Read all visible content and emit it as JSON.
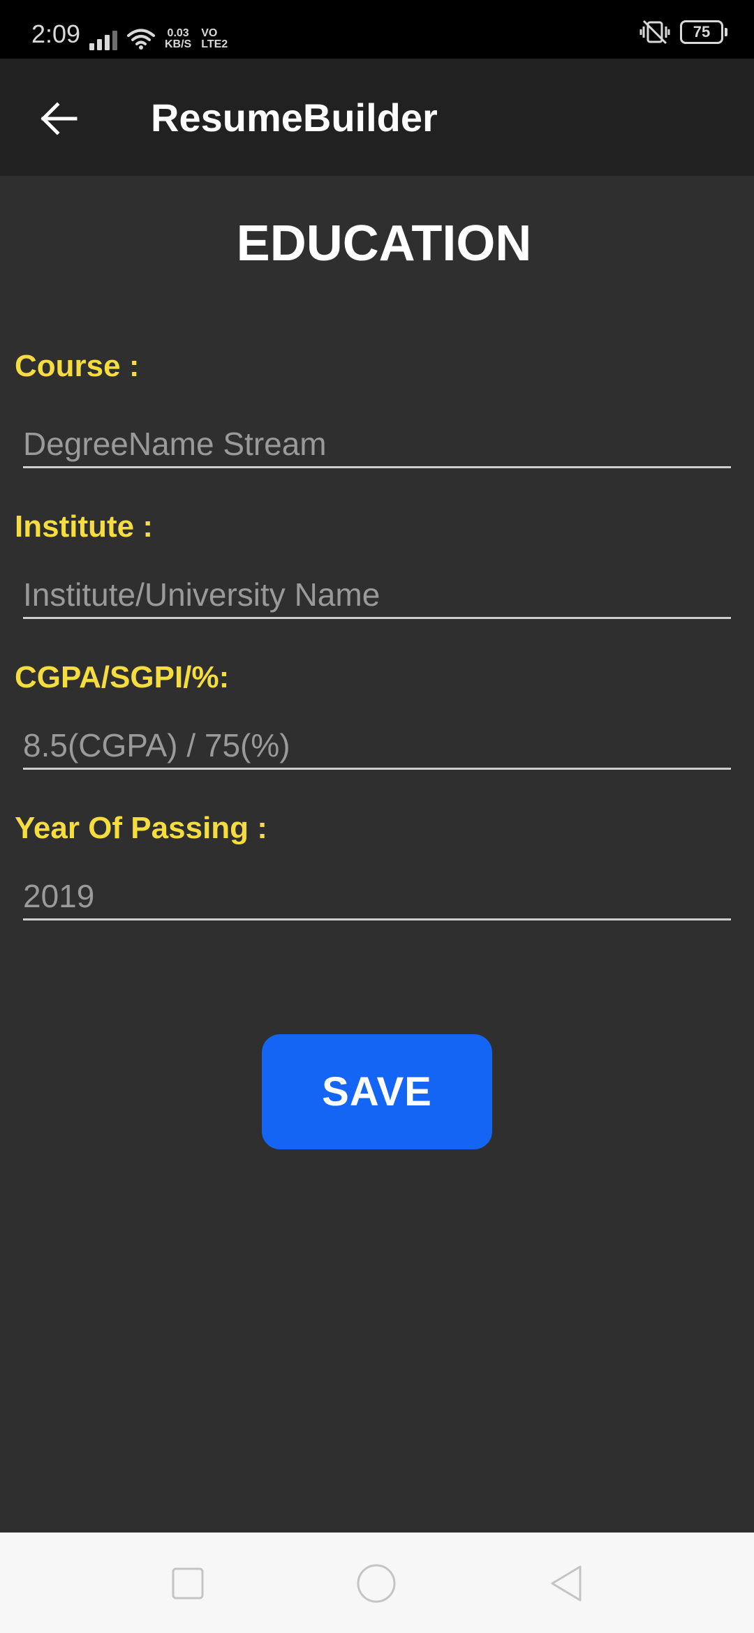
{
  "status_bar": {
    "time": "2:09",
    "net_speed_value": "0.03",
    "net_speed_unit": "KB/S",
    "volte_line1": "VO",
    "volte_line2": "LTE2",
    "battery_level": "75",
    "icons": [
      "signal-icon",
      "wifi-icon",
      "vibrate-mute-icon",
      "battery-icon"
    ]
  },
  "app_bar": {
    "title": "ResumeBuilder",
    "back_icon": "arrow-left-icon"
  },
  "page": {
    "heading": "EDUCATION"
  },
  "form": {
    "course_label": "Course :",
    "course_placeholder": "DegreeName Stream",
    "institute_label": "Institute :",
    "institute_placeholder": "Institute/University Name",
    "cgpa_label": "CGPA/SGPI/%:",
    "cgpa_placeholder": "8.5(CGPA) / 75(%)",
    "year_label": "Year Of Passing :",
    "year_placeholder": "2019",
    "save_label": "SAVE"
  },
  "nav_bar": {
    "icons": [
      "recents-square-icon",
      "home-circle-icon",
      "back-triangle-icon"
    ]
  },
  "colors": {
    "label_yellow": "#f5dd3f",
    "save_blue": "#1565f4",
    "background": "#2f2f2f",
    "app_bar": "#212121"
  }
}
